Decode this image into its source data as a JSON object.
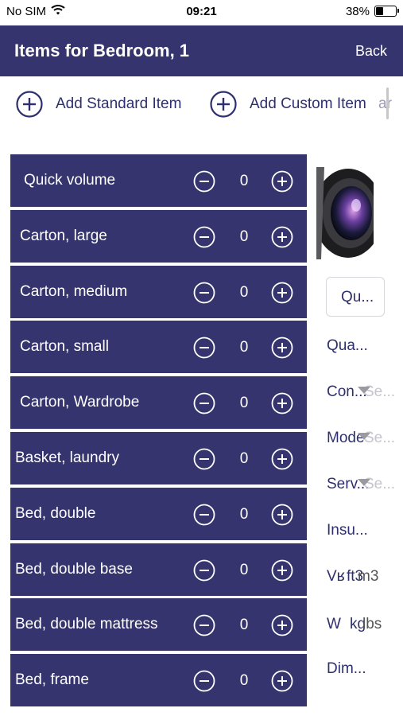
{
  "status_bar": {
    "carrier": "No SIM",
    "time": "09:21",
    "battery": "38%"
  },
  "nav": {
    "title": "Items for Bedroom, 1",
    "back_label": "Back"
  },
  "add_bar": {
    "standard_label": "Add Standard Item",
    "custom_label": "Add Custom Item",
    "ghost_text": "ar"
  },
  "items": [
    {
      "name": "Quick volume",
      "qty": "0"
    },
    {
      "name": "Carton, large",
      "qty": "0"
    },
    {
      "name": "Carton, medium",
      "qty": "0"
    },
    {
      "name": "Carton, small",
      "qty": "0"
    },
    {
      "name": "Carton, Wardrobe",
      "qty": "0"
    },
    {
      "name": "Basket, laundry",
      "qty": "0"
    },
    {
      "name": "Bed, double",
      "qty": "0"
    },
    {
      "name": "Bed, double base",
      "qty": "0"
    },
    {
      "name": "Bed, double mattress",
      "qty": "0"
    },
    {
      "name": "Bed, frame",
      "qty": "0"
    }
  ],
  "side_panel": {
    "button_label": "Qu...",
    "labels": [
      "Qua...",
      "Con...",
      "Mode",
      "Serv...",
      "Insu...",
      "Vʁ",
      "W",
      "Dim..."
    ],
    "ghost_texts": [
      "Se...",
      "Se...",
      "Se...",
      "ft3",
      "m3",
      "kg",
      "lbs"
    ]
  },
  "colors": {
    "primary": "#35346e",
    "accent_text": "#2e2f6e"
  }
}
